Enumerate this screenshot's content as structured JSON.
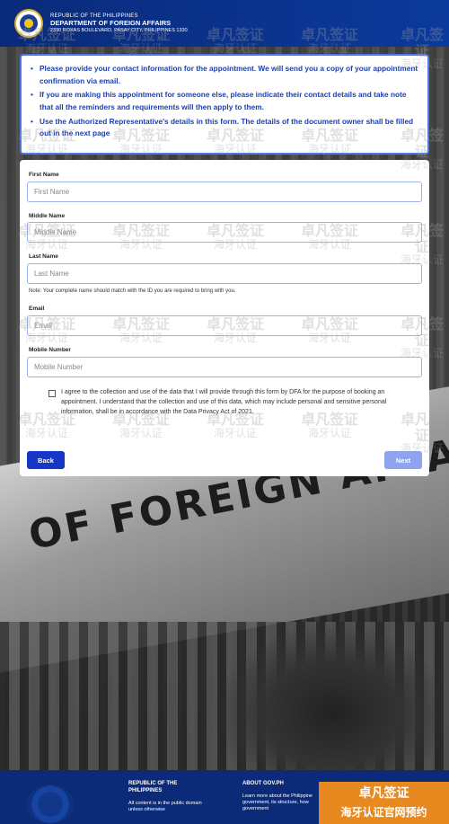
{
  "header": {
    "line1": "REPUBLIC OF THE PHILIPPINES",
    "line2": "DEPARTMENT OF FOREIGN AFFAIRS",
    "line3": "2330 ROXAS BOULEVARD, PASAY CITY, PHILIPPINES 1330"
  },
  "info": {
    "items": [
      "Please provide your contact information for the appointment. We will send you a copy of your appointment confirmation via email.",
      "If you are making this appointment for someone else, please indicate their contact details and take note that all the reminders and requirements will then apply to them.",
      "Use the Authorized Representative's details in this form. The details of the document owner shall be filled out in the next page"
    ]
  },
  "form": {
    "first_name": {
      "label": "First Name",
      "placeholder": "First Name",
      "value": ""
    },
    "middle_name": {
      "label": "Middle Name",
      "placeholder": "Middle Name",
      "value": ""
    },
    "last_name": {
      "label": "Last Name",
      "placeholder": "Last Name",
      "value": ""
    },
    "name_note": "Note: Your complete name should match with the ID you are required to bring with you.",
    "email": {
      "label": "Email",
      "placeholder": "Email",
      "value": ""
    },
    "mobile": {
      "label": "Mobile Number",
      "placeholder": "Mobile Number",
      "value": ""
    },
    "consent_text": "I agree to the collection and use of the data that I will provide through this form by DFA for the purpose of booking an appointment. I understand that the collection and use of this data, which may include personal and sensitive personal information, shall be in accordance with the Data Privacy Act of 2021.",
    "consent_checked": false,
    "back_label": "Back",
    "next_label": "Next"
  },
  "background": {
    "building_text": "OF FOREIGN AFFAIRS"
  },
  "footer": {
    "col1_title": "REPUBLIC OF THE PHILIPPINES",
    "col1_text": "All content is in the public domain unless otherwise",
    "col2_title": "ABOUT GOV.PH",
    "col2_text": "Learn more about the Philippine government, its structure, how government"
  },
  "watermark": {
    "line1": "卓凡签证",
    "line2": "海牙认证"
  },
  "promo": {
    "line1": "卓凡签证",
    "line2": "海牙认证官网预约"
  },
  "colors": {
    "header_bg": "#0b3a9c",
    "info_text": "#1b3fb0",
    "back_button": "#1636c8",
    "next_button_disabled": "#8ea4ee",
    "promo_bg": "#e8891f"
  }
}
